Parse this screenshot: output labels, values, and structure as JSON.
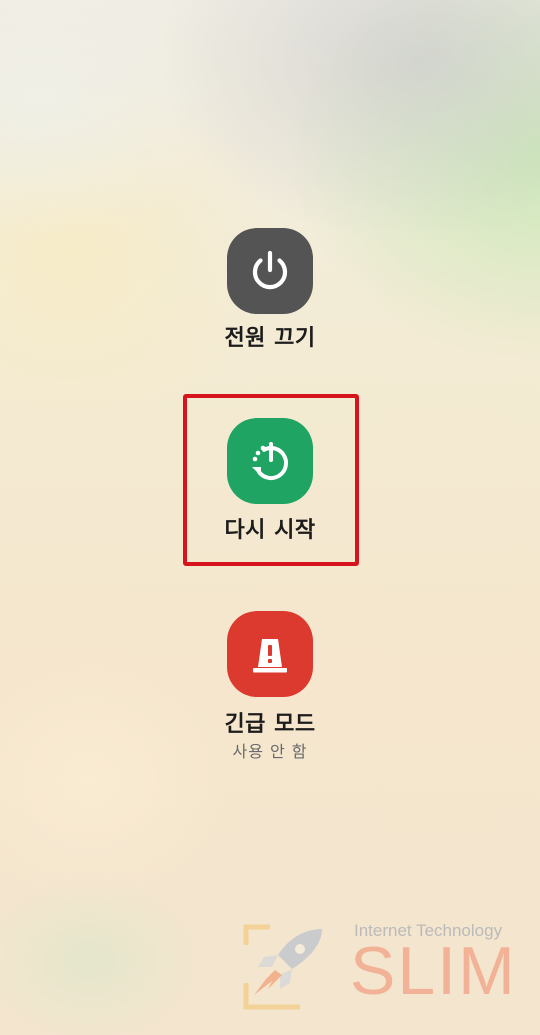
{
  "menu": {
    "power_off": {
      "label": "전원 끄기",
      "icon": "power-icon",
      "color": "#545454"
    },
    "restart": {
      "label": "다시 시작",
      "icon": "restart-icon",
      "color": "#1fa463"
    },
    "emergency": {
      "label": "긴급 모드",
      "sublabel": "사용 안 함",
      "icon": "emergency-siren-icon",
      "color": "#dc3a2e"
    }
  },
  "highlight": {
    "color": "#d6141e"
  },
  "watermark": {
    "caption": "Internet Technology",
    "brand": "SLIM"
  }
}
